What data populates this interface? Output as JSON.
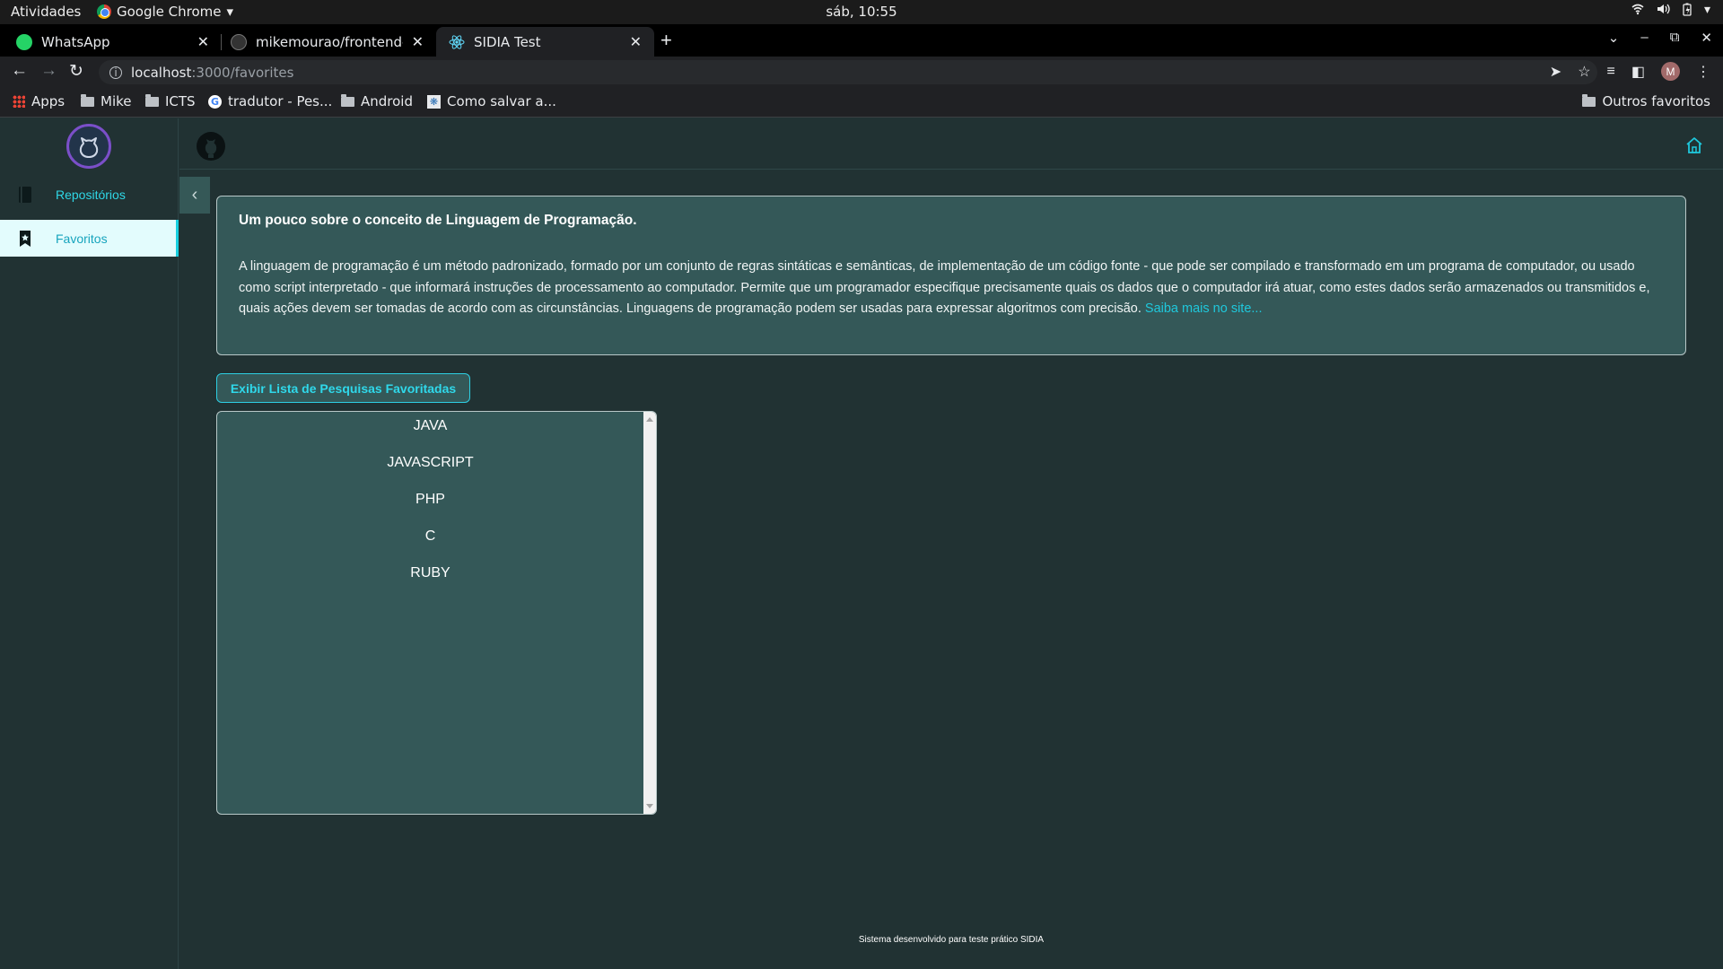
{
  "os": {
    "activities": "Atividades",
    "app_name": "Google Chrome",
    "clock": "sáb, 10:55"
  },
  "browser": {
    "tabs": [
      {
        "title": "WhatsApp",
        "active": false
      },
      {
        "title": "mikemourao/frontend-re",
        "active": false
      },
      {
        "title": "SIDIA Test",
        "active": true
      }
    ],
    "url_host": "localhost",
    "url_path": ":3000/favorites",
    "profile_initial": "M",
    "bookmarks": {
      "apps": "Apps",
      "mike": "Mike",
      "icts": "ICTS",
      "tradutor": "tradutor - Pes...",
      "android": "Android",
      "como_salvar": "Como salvar a...",
      "outros": "Outros favoritos"
    }
  },
  "sidebar": {
    "items": [
      {
        "label": "Repositórios",
        "active": false
      },
      {
        "label": "Favoritos",
        "active": true
      }
    ]
  },
  "info_card": {
    "title": "Um pouco sobre o conceito de Linguagem de Programação.",
    "body": "A linguagem de programação é um método padronizado, formado por um conjunto de regras sintáticas e semânticas, de implementação de um código fonte - que pode ser compilado e transformado em um programa de computador, ou usado como script interpretado - que informará instruções de processamento ao computador. Permite que um programador especifique precisamente quais os dados que o computador irá atuar, como estes dados serão armazenados ou transmitidos e, quais ações devem ser tomadas de acordo com as circunstâncias. Linguagens de programação podem ser usadas para expressar algoritmos com precisão.",
    "link": "Saiba mais no site..."
  },
  "favorites": {
    "button_label": "Exibir Lista de Pesquisas Favoritadas",
    "items": [
      "JAVA",
      "JAVASCRIPT",
      "PHP",
      "C",
      "RUBY"
    ]
  },
  "footer": {
    "text": "Sistema desenvolvido para teste prático SIDIA"
  },
  "colors": {
    "page_bg": "#213233",
    "card_bg": "#345858",
    "accent": "#2fd7e6"
  }
}
